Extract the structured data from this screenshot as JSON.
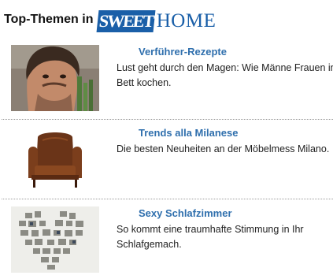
{
  "header": {
    "title": "Top-Themen in",
    "brand": {
      "part1": "SWEET",
      "part2": "HOME"
    }
  },
  "items": [
    {
      "headline": "Verführer-Rezepte",
      "text": "Lust geht durch den Magen: Wie Männe Frauen ins Bett kochen."
    },
    {
      "headline": "Trends alla Milanese",
      "text": "Die besten Neuheiten an der Möbelmess Milano."
    },
    {
      "headline": "Sexy Schlafzimmer",
      "text": "So kommt eine traumhafte Stimmung in Ihr Schlafgemach."
    }
  ],
  "colors": {
    "link": "#2f6fad",
    "brand": "#1a5fa8"
  }
}
